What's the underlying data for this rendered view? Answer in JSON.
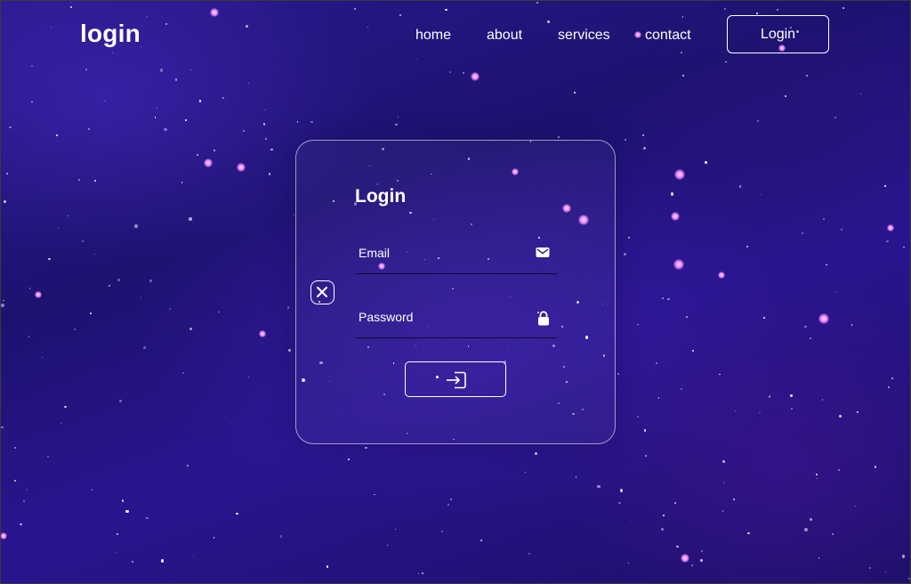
{
  "header": {
    "logo": "login",
    "nav": [
      "home",
      "about",
      "services",
      "contact"
    ],
    "login_button": "Login"
  },
  "form": {
    "title": "Login",
    "email_placeholder": "Email",
    "password_placeholder": "Password",
    "close_icon": "close-icon",
    "email_icon": "mail-icon",
    "password_icon": "lock-icon",
    "submit_icon": "login-icon"
  },
  "colors": {
    "background": "#21148a",
    "accent": "#ffffff",
    "star_pink": "#e07bff"
  }
}
